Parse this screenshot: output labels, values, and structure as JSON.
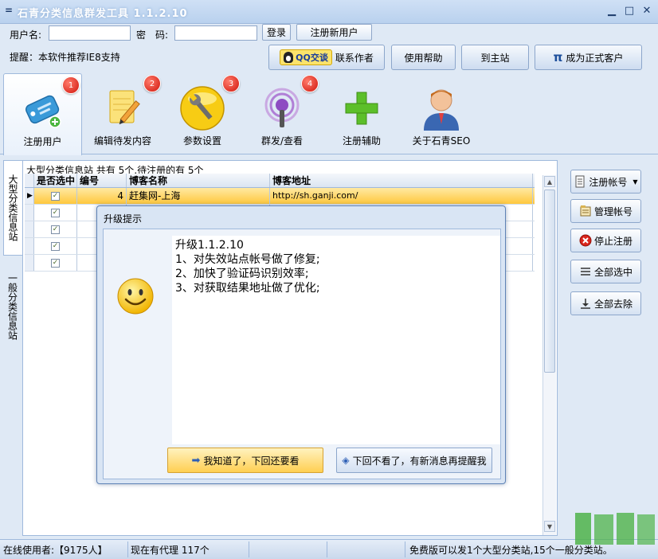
{
  "window": {
    "title": "石青分类信息群发工具 1.1.2.10",
    "sysmenu_icon": "="
  },
  "login": {
    "username_label": "用户名:",
    "username_value": "",
    "password_label": "密　码:",
    "password_value": "",
    "login_button": "登录",
    "register_button": "注册新用户",
    "tip": "提醒：本软件推荐IE8支持"
  },
  "top_buttons": {
    "qq_badge": "QQ交谈",
    "contact": "联系作者",
    "help": "使用帮助",
    "home": "到主站",
    "pi": "π",
    "become_customer": "成为正式客户"
  },
  "toolbar": [
    {
      "label": "注册用户",
      "badge": "1"
    },
    {
      "label": "编辑待发内容",
      "badge": "2"
    },
    {
      "label": "参数设置",
      "badge": "3"
    },
    {
      "label": "群发/查看",
      "badge": "4"
    },
    {
      "label": "注册辅助",
      "badge": ""
    },
    {
      "label": "关于石青SEO",
      "badge": ""
    }
  ],
  "side_tabs": {
    "large": "大型分类信息站",
    "general": "一般分类信息站"
  },
  "grid": {
    "caption": "大型分类信息站 共有 5个,待注册的有 5个",
    "headers": [
      "是否选中",
      "编号",
      "博客名称",
      "博客地址"
    ],
    "rows": [
      {
        "marker": "▶",
        "checked": "✓",
        "id": "4",
        "name": "赶集网-上海",
        "url": "http://sh.ganji.com/"
      },
      {
        "marker": "",
        "checked": "✓",
        "id": "",
        "name": "",
        "url": ""
      },
      {
        "marker": "",
        "checked": "✓",
        "id": "",
        "name": "",
        "url": ""
      },
      {
        "marker": "",
        "checked": "✓",
        "id": "",
        "name": "",
        "url": ""
      },
      {
        "marker": "",
        "checked": "✓",
        "id": "",
        "name": "",
        "url": ""
      }
    ]
  },
  "right_buttons": {
    "register_account": "注册帐号",
    "manage_account": "管理帐号",
    "stop_register": "停止注册",
    "select_all": "全部选中",
    "remove_all": "全部去除"
  },
  "status": {
    "online": "在线使用者:【9175人】",
    "proxy": "现在有代理 117个",
    "free_note": "免费版可以发1个大型分类站,15个一般分类站。"
  },
  "dialog": {
    "title": "升级提示",
    "lines": [
      "升级1.1.2.10",
      "1、对失效站点帐号做了修复;",
      "2、加快了验证码识别效率;",
      "3、对获取结果地址做了优化;"
    ],
    "btn_ok": "我知道了，下回还要看",
    "btn_never": "下回不看了，有新消息再提醒我"
  },
  "colors": {
    "accent": "#ffc83d",
    "badge": "#d0140b",
    "frame": "#9fb9dc"
  }
}
